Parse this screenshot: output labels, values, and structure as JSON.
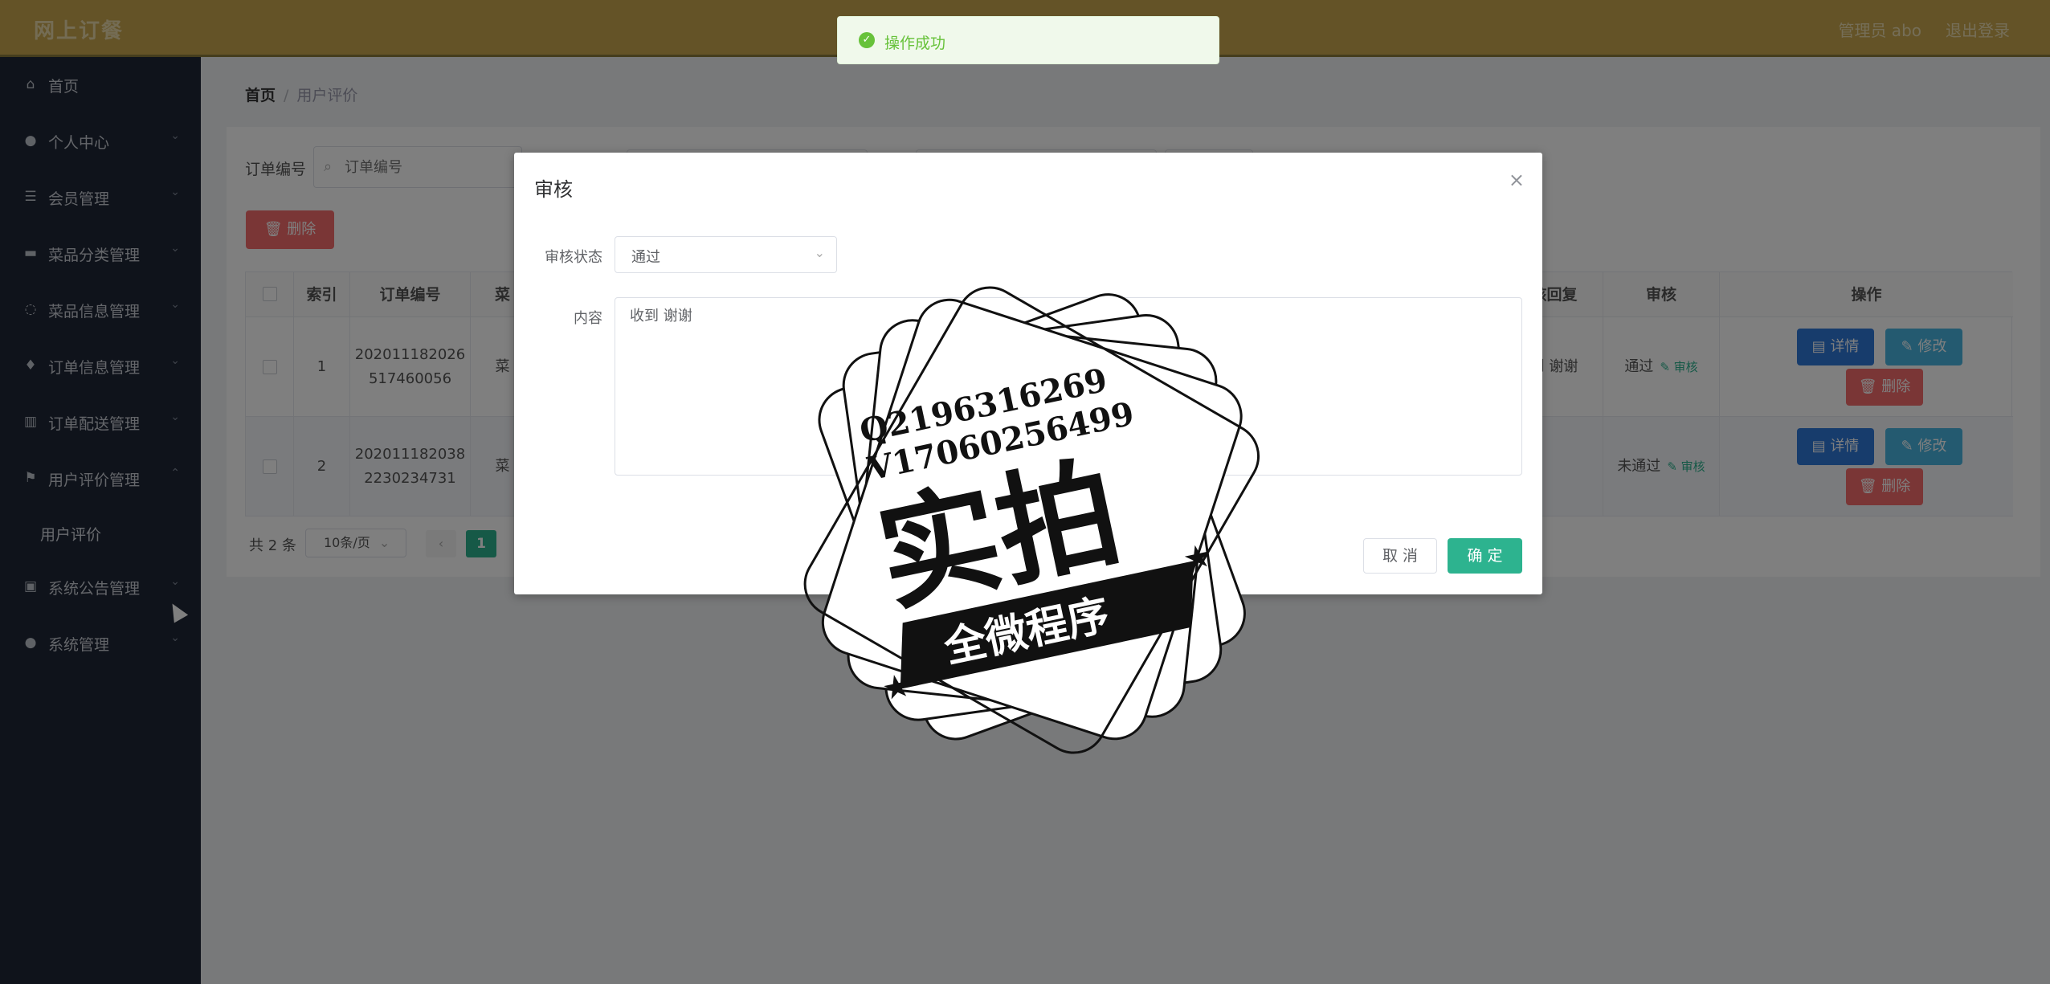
{
  "header": {
    "brand": "网上订餐",
    "admin": "管理员 abo",
    "logout": "退出登录"
  },
  "sidebar": {
    "items": [
      {
        "label": "首页",
        "icon": "home-icon"
      },
      {
        "label": "个人中心",
        "icon": "user-icon"
      },
      {
        "label": "会员管理",
        "icon": "list-icon"
      },
      {
        "label": "菜品分类管理",
        "icon": "monitor-icon"
      },
      {
        "label": "菜品信息管理",
        "icon": "power-icon"
      },
      {
        "label": "订单信息管理",
        "icon": "mic-icon"
      },
      {
        "label": "订单配送管理",
        "icon": "chart-icon"
      },
      {
        "label": "用户评价管理",
        "icon": "flag-icon"
      },
      {
        "label": "系统公告管理",
        "icon": "briefcase-icon"
      },
      {
        "label": "系统管理",
        "icon": "location-icon"
      }
    ],
    "sub_item": "用户评价"
  },
  "breadcrumb": {
    "home": "首页",
    "sep": "/",
    "current": "用户评价"
  },
  "search": {
    "label": "订单编号",
    "placeholder": "订单编号"
  },
  "toolbar": {
    "delete_label": "删除"
  },
  "table": {
    "headers": [
      "索引",
      "订单编号",
      "菜",
      "审核回复",
      "审核",
      "操作"
    ],
    "rows": [
      {
        "index": "1",
        "order_no_1": "202011182026",
        "order_no_2": "517460056",
        "dish": "菜",
        "reply": "收到 谢谢",
        "status": "通过",
        "audit": "审核"
      },
      {
        "index": "2",
        "order_no_1": "202011182038",
        "order_no_2": "2230234731",
        "dish": "菜",
        "reply": "",
        "status": "未通过",
        "audit": "审核"
      }
    ],
    "actions": {
      "detail": "详情",
      "edit": "修改",
      "delete": "删除"
    }
  },
  "pager": {
    "total": "共 2 条",
    "size": "10条/页",
    "current_page": "1"
  },
  "toast": {
    "message": "操作成功"
  },
  "dialog": {
    "title": "审核",
    "status_label": "审核状态",
    "status_value": "通过",
    "content_label": "内容",
    "content_value": "收到 谢谢",
    "cancel": "取 消",
    "confirm": "确 定"
  },
  "watermark": {
    "line1": "Q2196316269",
    "line2": "V17060256499",
    "big": "实拍",
    "ribbon": "全微程序"
  }
}
